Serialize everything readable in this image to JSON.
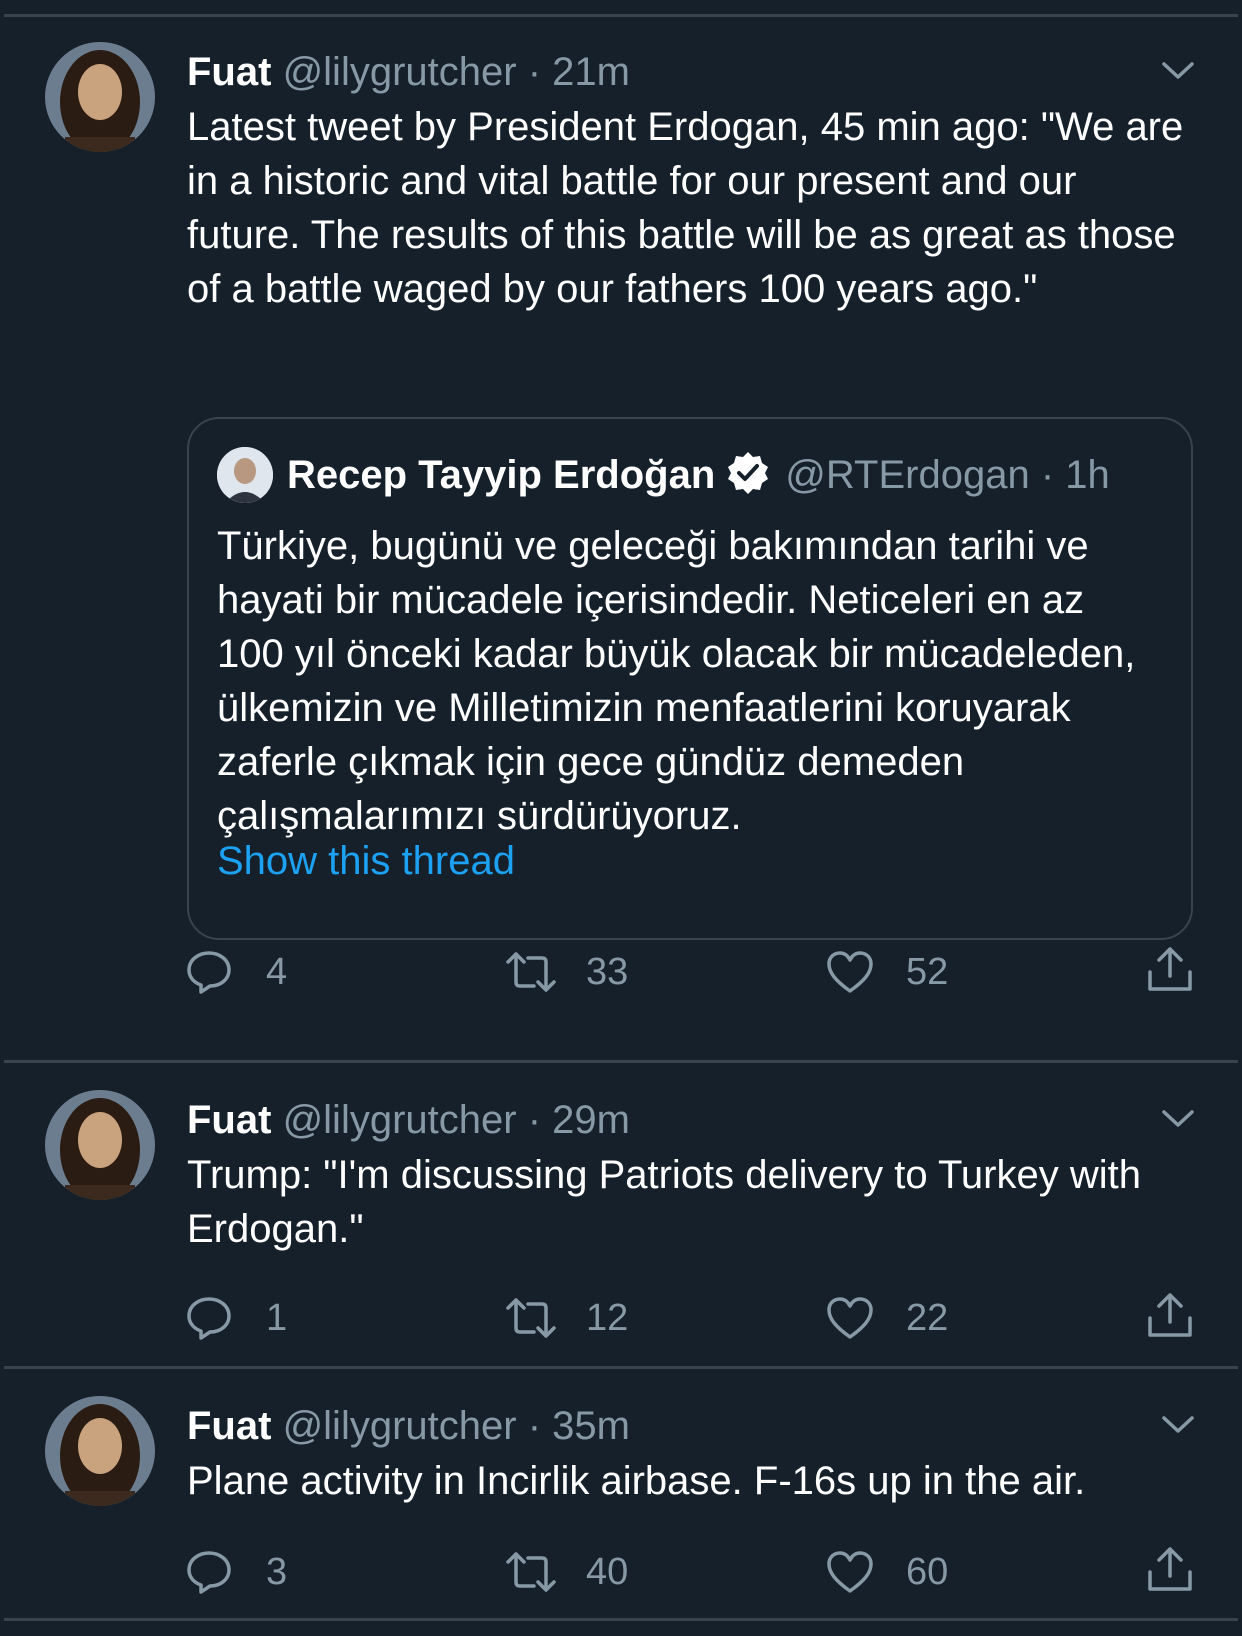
{
  "tweets": [
    {
      "name": "Fuat",
      "handle": "@lilygrutcher",
      "separator": "·",
      "time": "21m",
      "text": "Latest tweet by President Erdogan, 45 min ago: \"We are in a historic and vital battle for our present and our future. The results of this battle will be as great as those of a battle waged by our fathers 100 years ago.\"",
      "quote": {
        "name": "Recep Tayyip Erdoğan",
        "handle": "@RTErdogan · 1h",
        "text": "Türkiye, bugünü ve geleceği bakımından tarihi ve hayati bir mücadele içerisindedir. Neticeleri en az 100 yıl önceki kadar büyük olacak bir mücadeleden, ülkemizin ve Milletimizin menfaatlerini koruyarak zaferle çıkmak için gece gündüz demeden çalışmalarımızı sürdürüyoruz.",
        "show_thread": "Show this thread"
      },
      "replies": "4",
      "retweets": "33",
      "likes": "52"
    },
    {
      "name": "Fuat",
      "handle": "@lilygrutcher",
      "separator": "·",
      "time": "29m",
      "text": "Trump: \"I'm discussing Patriots delivery to Turkey with Erdogan.\"",
      "replies": "1",
      "retweets": "12",
      "likes": "22"
    },
    {
      "name": "Fuat",
      "handle": "@lilygrutcher",
      "separator": "·",
      "time": "35m",
      "text": "Plane activity in Incirlik airbase. F-16s up in the air.",
      "replies": "3",
      "retweets": "40",
      "likes": "60"
    }
  ],
  "colors": {
    "background": "#15202b",
    "secondary_text": "#8899a6",
    "link": "#1da1f2",
    "divider": "#38444d"
  },
  "icons": {
    "reply": "reply-icon",
    "retweet": "retweet-icon",
    "like": "heart-icon",
    "share": "share-icon",
    "more": "chevron-down-icon",
    "verified": "verified-badge-icon"
  }
}
